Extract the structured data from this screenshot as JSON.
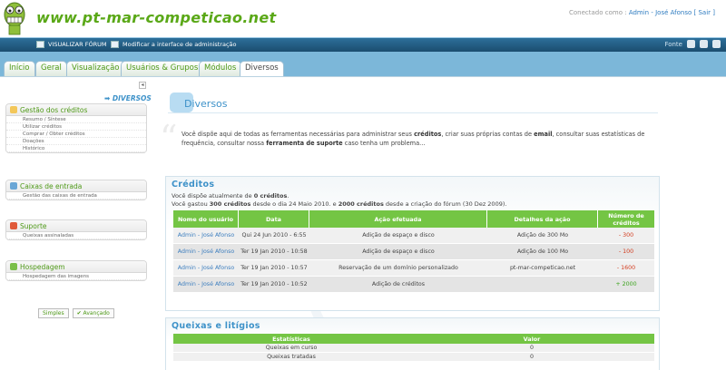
{
  "header": {
    "site_title": "www.pt-mar-competicao.net",
    "connected_as": "Conectado como :",
    "user_name": "Admin - José Afonso",
    "separator": "[",
    "logout": "Sair ]"
  },
  "toolbar": {
    "view_forum": "VISUALIZAR FÓRUM",
    "modify_interface": "Modificar a interface de administração",
    "right_label": "Fonte"
  },
  "tabs": [
    {
      "label": "Início"
    },
    {
      "label": "Geral"
    },
    {
      "label": "Visualização"
    },
    {
      "label": "Usuários & Grupos"
    },
    {
      "label": "Módulos"
    },
    {
      "label": "Diversos"
    }
  ],
  "sidebar": {
    "collapse": "◂",
    "heading": "➡ DIVERSOS",
    "sections": [
      {
        "title": "Gestão dos créditos",
        "items": [
          "Resumo / Síntese",
          "Utilizar créditos",
          "Comprar / Obter créditos",
          "Doações",
          "Histórico"
        ]
      },
      {
        "title": "Caixas de entrada",
        "items": [
          "Gestão das caixas de entrada"
        ]
      },
      {
        "title": "Suporte",
        "items": [
          "Queixas assinaladas"
        ]
      },
      {
        "title": "Hospedagem",
        "items": [
          "Hospedagem das imagens"
        ]
      }
    ],
    "mode_simple": "Simples",
    "mode_advanced": "✔ Avançado"
  },
  "colors": {
    "accent_green": "#4f9a18",
    "accent_blue": "#3e92c9",
    "table_header": "#74c544",
    "negative": "#d23a1c",
    "positive": "#3aa31b"
  },
  "main": {
    "page_title": "Diversos",
    "intro_1": "Você dispõe aqui de todas as ferramentas necessárias para administrar seus ",
    "intro_b1": "créditos",
    "intro_2": ", criar suas próprias contas de ",
    "intro_b2": "email",
    "intro_3": ", consultar suas estatísticas de frequência, consultar nossa ",
    "intro_b3": "ferramenta de suporte",
    "intro_4": " caso tenha um problema...",
    "credits": {
      "heading": "Créditos",
      "line1_a": "Você dispõe atualmente de ",
      "line1_b": "0 créditos",
      "line1_c": ".",
      "line2_a": "Você gastou ",
      "line2_b": "300 créditos",
      "line2_c": " desde o dia 24 Maio 2010. e ",
      "line2_d": "2000 créditos",
      "line2_e": " desde a criação do fórum (30 Dez 2009).",
      "columns": [
        "Nome do usuário",
        "Data",
        "Ação efetuada",
        "Detalhes da ação",
        "Número de créditos"
      ],
      "rows": [
        {
          "user": "Admin - José Afonso",
          "date": "Qui 24 Jun 2010 - 6:55",
          "action": "Adição de espaço e disco",
          "details": "Adição de 300 Mo",
          "credits": "- 300"
        },
        {
          "user": "Admin - José Afonso",
          "date": "Ter 19 Jan 2010 - 10:58",
          "action": "Adição de espaço e disco",
          "details": "Adição de 100 Mo",
          "credits": "- 100"
        },
        {
          "user": "Admin - José Afonso",
          "date": "Ter 19 Jan 2010 - 10:57",
          "action": "Reservação de um domínio personalizado",
          "details": "pt-mar-competicao.net",
          "credits": "- 1600"
        },
        {
          "user": "Admin - José Afonso",
          "date": "Ter 19 Jan 2010 - 10:52",
          "action": "Adição de créditos",
          "details": "",
          "credits": "+ 2000"
        }
      ]
    },
    "complaints": {
      "heading": "Queixas e litígios",
      "columns": [
        "Estatísticas",
        "Valor"
      ],
      "rows": [
        {
          "label": "Queixas em curso",
          "value": "0"
        },
        {
          "label": "Queixas tratadas",
          "value": "0"
        }
      ]
    }
  }
}
